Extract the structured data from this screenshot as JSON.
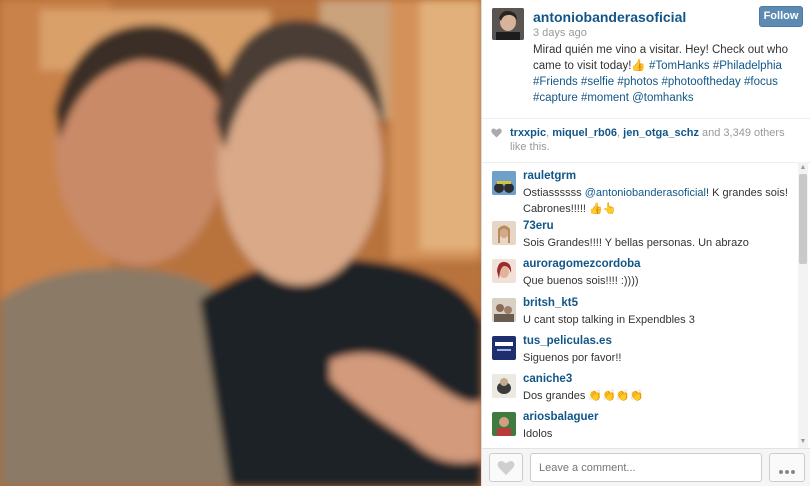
{
  "post": {
    "username": "antoniobanderasoficial",
    "time_ago": "3 days ago",
    "follow_label": "Follow",
    "caption_text": "Mirad quién me vino a visitar. Hey! Check out who came to visit today!👍 ",
    "caption_tags": "#TomHanks #Philadelphia #Friends #selfie #photos #photooftheday #focus #capture #moment @tomhanks"
  },
  "likes": {
    "likers": [
      "trxxpic",
      "miquel_rb06",
      "jen_otga_schz"
    ],
    "suffix": "and 3,349 others like this."
  },
  "comments": [
    {
      "user": "rauletgrm",
      "text_mention": "@antoniobanderasoficial",
      "text_before": "Ostiassssss ",
      "text_after": "! K grandes sois! Cabrones!!!!! 👍👆",
      "avatar_color": "#5f8f4e"
    },
    {
      "user": "73eru",
      "text": "Sois Grandes!!!! Y bellas personas. Un abrazo",
      "avatar_color": "#d8b89a"
    },
    {
      "user": "auroragomezcordoba",
      "text": "Que buenos sois!!!! :))))",
      "avatar_color": "#a83a3a"
    },
    {
      "user": "britsh_kt5",
      "text": "U cant stop talking in Expendbles 3",
      "avatar_color": "#9a8a7a"
    },
    {
      "user": "tus_peliculas.es",
      "text": "Siguenos por favor!!",
      "avatar_color": "#2a3c7a"
    },
    {
      "user": "caniche3",
      "text": "Dos grandes 👏👏👏👏",
      "avatar_color": "#c9c2b8"
    },
    {
      "user": "ariosbalaguer",
      "text": "Idolos",
      "avatar_color": "#3f7a3f"
    }
  ],
  "footer": {
    "comment_placeholder": "Leave a comment..."
  }
}
